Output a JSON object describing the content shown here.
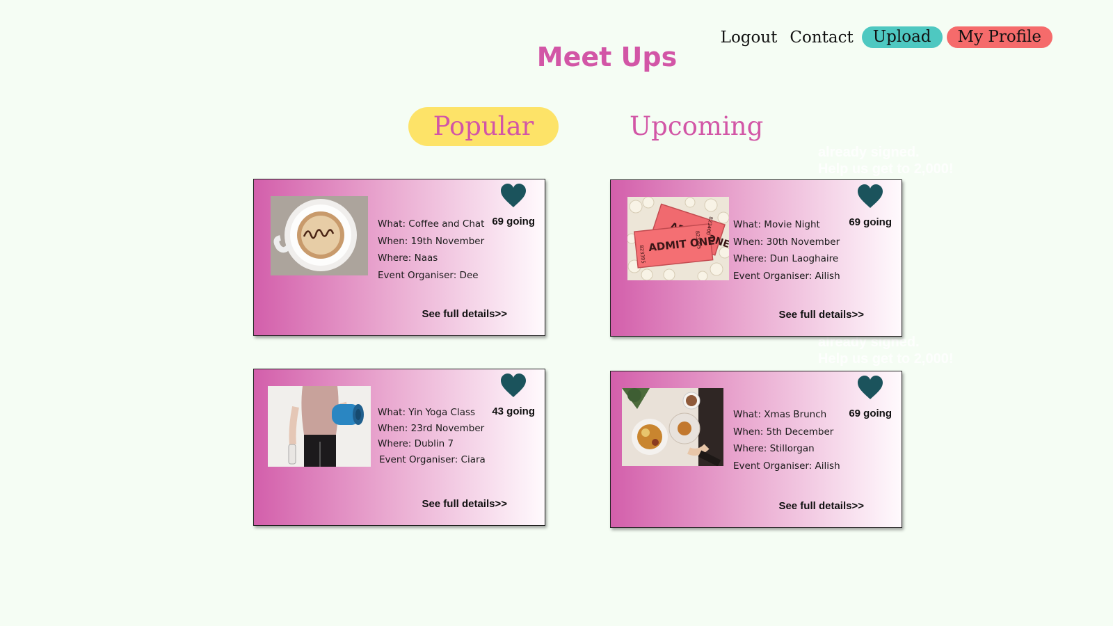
{
  "nav": {
    "logout": "Logout",
    "contact": "Contact",
    "upload": "Upload",
    "profile": "My Profile"
  },
  "page_title": "Meet Ups",
  "tabs": {
    "popular": "Popular",
    "upcoming": "Upcoming"
  },
  "ghost_text": {
    "top": [
      "already signed.",
      "Help us get to 2,000!"
    ],
    "bottom": [
      "already signed.",
      "Help us get to 2,000!"
    ]
  },
  "events": [
    {
      "what": "What: Coffee and Chat",
      "when": "When: 19th November",
      "where": "Where: Naas",
      "organiser": "Event Organiser: Dee",
      "going": "69 going",
      "details": "See full details>>",
      "image": "coffee-cup-image"
    },
    {
      "what": "What: Movie Night",
      "when": "When: 30th November",
      "where": "Where: Dun Laoghaire",
      "organiser": "Event Organiser: Ailish",
      "going": "69 going",
      "details": "See full details>>",
      "image": "movie-tickets-popcorn-image",
      "ticket_text": "ADMIT ONE",
      "ticket_numbers": [
        "823395",
        "823400"
      ]
    },
    {
      "what": "What: Yin Yoga Class",
      "when": "When: 23rd November",
      "where": "Where: Dublin 7",
      "organiser": "Event Organiser: Ciara",
      "going": "43 going",
      "details": "See full details>>",
      "image": "yoga-mat-person-image"
    },
    {
      "what": "What: Xmas Brunch",
      "when": "When: 5th December",
      "where": "Where: Stillorgan",
      "organiser": "Event Organiser: Ailish",
      "going": "69 going",
      "details": "See full details>>",
      "image": "brunch-table-image"
    }
  ],
  "colors": {
    "title": "#d256a6",
    "active_tab": "#fde368",
    "upload": "#4ec8c1",
    "profile": "#f56b6b",
    "heart": "#1b535c"
  },
  "icons": {
    "heart": "heart-icon"
  }
}
